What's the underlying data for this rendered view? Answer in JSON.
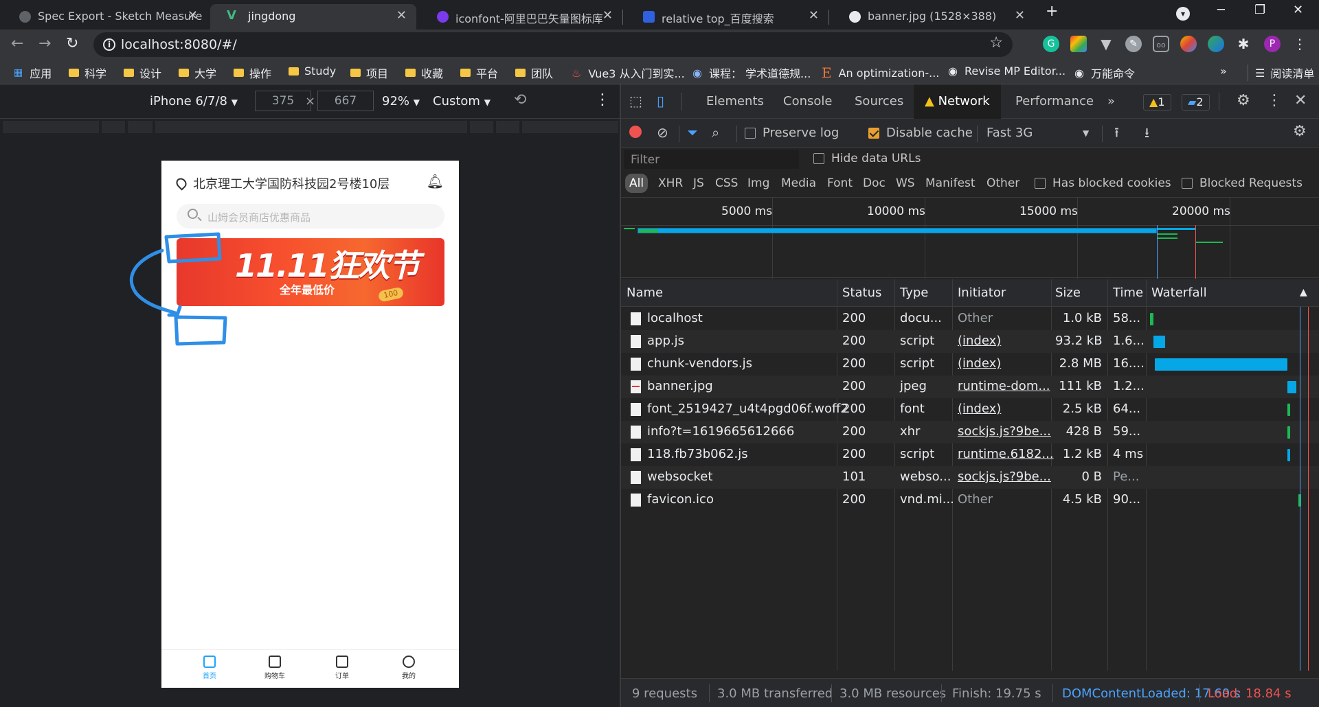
{
  "browser": {
    "tabs": [
      {
        "title": "Spec Export - Sketch Measure",
        "favicon_color": "#5f6368"
      },
      {
        "title": "jingdong",
        "favicon_color": "#41b883"
      },
      {
        "title": "iconfont-阿里巴巴矢量图标库",
        "favicon_color": "#7b3aed"
      },
      {
        "title": "relative top_百度搜索",
        "favicon_color": "#3060e0"
      },
      {
        "title": "banner.jpg (1528×388)",
        "favicon_color": "#e8eaed"
      }
    ],
    "new_tab_icon": "plus-icon",
    "url": "localhost:8080/#/",
    "bookmarks": [
      {
        "label": "应用",
        "icon": "apps-grid-icon"
      },
      {
        "label": "科学",
        "icon": "folder-icon"
      },
      {
        "label": "设计",
        "icon": "folder-icon"
      },
      {
        "label": "大学",
        "icon": "folder-icon"
      },
      {
        "label": "操作",
        "icon": "folder-icon"
      },
      {
        "label": "Study",
        "icon": "folder-icon"
      },
      {
        "label": "项目",
        "icon": "folder-icon"
      },
      {
        "label": "收藏",
        "icon": "folder-icon"
      },
      {
        "label": "平台",
        "icon": "folder-icon"
      },
      {
        "label": "团队",
        "icon": "folder-icon"
      },
      {
        "label": "Vue3 从入门到实...",
        "icon": "flame-icon"
      },
      {
        "label": "课程：  学术道德规...",
        "icon": "globe-icon"
      },
      {
        "label": "An optimization-...",
        "icon": "e-icon"
      },
      {
        "label": "Revise MP Editor...",
        "icon": "globe-icon"
      },
      {
        "label": "万能命令",
        "icon": "globe-icon"
      }
    ],
    "bookmarks_more": "»",
    "reading_list": "阅读清单",
    "profile_initial": "P"
  },
  "device_toolbar": {
    "device": "iPhone 6/7/8",
    "width": "375",
    "height": "667",
    "times": "×",
    "zoom": "92%",
    "throttle": "Custom"
  },
  "app": {
    "location": "北京理工大学国防科技园2号楼10层",
    "search_placeholder": "山姆会员商店优惠商品",
    "banner_title": "11.11狂欢节",
    "banner_sub": "全年最低价",
    "banner_coin": "100",
    "nav": [
      {
        "label": "首页",
        "active": true
      },
      {
        "label": "购物车",
        "active": false
      },
      {
        "label": "订单",
        "active": false
      },
      {
        "label": "我的",
        "active": false
      }
    ]
  },
  "devtools": {
    "tabs": [
      "Elements",
      "Console",
      "Sources",
      "Network",
      "Performance"
    ],
    "active_tab": "Network",
    "more_tabs": "»",
    "warnings": "1",
    "messages": "2",
    "preserve_log": "Preserve log",
    "disable_cache": "Disable cache",
    "throttling": "Fast 3G",
    "filter_placeholder": "Filter",
    "hide_data_urls": "Hide data URLs",
    "types": [
      "All",
      "XHR",
      "JS",
      "CSS",
      "Img",
      "Media",
      "Font",
      "Doc",
      "WS",
      "Manifest",
      "Other"
    ],
    "has_blocked_cookies": "Has blocked cookies",
    "blocked_requests": "Blocked Requests",
    "overview_ticks": [
      "5000 ms",
      "10000 ms",
      "15000 ms",
      "20000 ms"
    ],
    "columns": [
      "Name",
      "Status",
      "Type",
      "Initiator",
      "Size",
      "Time",
      "Waterfall"
    ],
    "requests": [
      {
        "name": "localhost",
        "status": "200",
        "type": "docu...",
        "initiator": "Other",
        "initiator_link": false,
        "size": "1.0 kB",
        "time": "58...",
        "wf_start": 0.01,
        "wf_len": 0.02,
        "wf_color": "#1db954"
      },
      {
        "name": "app.js",
        "status": "200",
        "type": "script",
        "initiator": "(index)",
        "initiator_link": true,
        "size": "93.2 kB",
        "time": "1.6...",
        "wf_start": 0.03,
        "wf_len": 0.08,
        "wf_color": "#06a7e6"
      },
      {
        "name": "chunk-vendors.js",
        "status": "200",
        "type": "script",
        "initiator": "(index)",
        "initiator_link": true,
        "size": "2.8 MB",
        "time": "16....",
        "wf_start": 0.04,
        "wf_len": 0.87,
        "wf_color": "#06a7e6"
      },
      {
        "name": "banner.jpg",
        "status": "200",
        "type": "jpeg",
        "initiator": "runtime-dom...",
        "initiator_link": true,
        "size": "111 kB",
        "time": "1.2...",
        "wf_start": 0.91,
        "wf_len": 0.06,
        "wf_color": "#06a7e6"
      },
      {
        "name": "font_2519427_u4t4pgd06f.woff2",
        "status": "200",
        "type": "font",
        "initiator": "(index)",
        "initiator_link": true,
        "size": "2.5 kB",
        "time": "64...",
        "wf_start": 0.91,
        "wf_len": 0.02,
        "wf_color": "#1db954"
      },
      {
        "name": "info?t=1619665612666",
        "status": "200",
        "type": "xhr",
        "initiator": "sockjs.js?9be...",
        "initiator_link": true,
        "size": "428 B",
        "time": "59...",
        "wf_start": 0.91,
        "wf_len": 0.02,
        "wf_color": "#1db954"
      },
      {
        "name": "118.fb73b062.js",
        "status": "200",
        "type": "script",
        "initiator": "runtime.6182...",
        "initiator_link": true,
        "size": "1.2 kB",
        "time": "4 ms",
        "wf_start": 0.91,
        "wf_len": 0.01,
        "wf_color": "#06a7e6"
      },
      {
        "name": "websocket",
        "status": "101",
        "type": "webso...",
        "initiator": "sockjs.js?9be...",
        "initiator_link": true,
        "size": "0 B",
        "time": "Pe...",
        "wf_start": 0.0,
        "wf_len": 0.0,
        "wf_color": "#06a7e6"
      },
      {
        "name": "favicon.ico",
        "status": "200",
        "type": "vnd.mi...",
        "initiator": "Other",
        "initiator_link": false,
        "size": "4.5 kB",
        "time": "90...",
        "wf_start": 0.98,
        "wf_len": 0.02,
        "wf_color": "#1db954"
      }
    ],
    "summary": {
      "requests": "9 requests",
      "transferred": "3.0 MB transferred",
      "resources": "3.0 MB resources",
      "finish": "Finish: 19.75 s",
      "dcl": "DOMContentLoaded: 17.60 s",
      "load": "Load: 18.84 s"
    }
  }
}
